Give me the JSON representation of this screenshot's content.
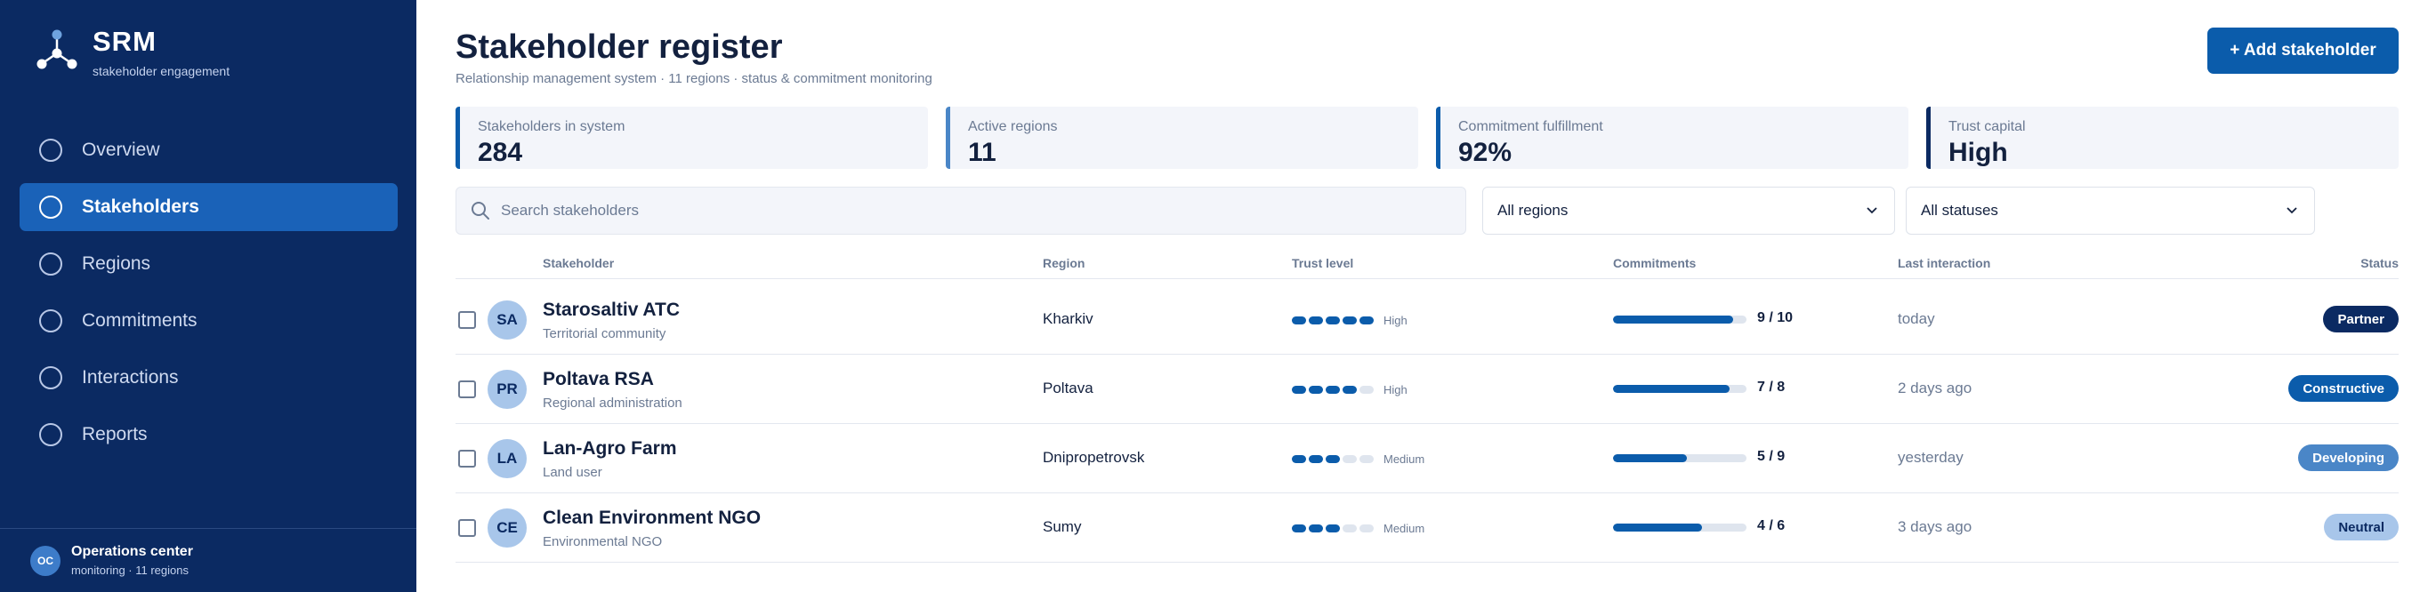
{
  "brand": {
    "name": "SRM",
    "subtitle": "stakeholder engagement"
  },
  "sidebar": {
    "items": [
      {
        "label": "Overview",
        "active": false
      },
      {
        "label": "Stakeholders",
        "active": true
      },
      {
        "label": "Regions",
        "active": false
      },
      {
        "label": "Commitments",
        "active": false
      },
      {
        "label": "Interactions",
        "active": false
      },
      {
        "label": "Reports",
        "active": false
      }
    ],
    "footer": {
      "initials": "OC",
      "title": "Operations center",
      "subtitle": "monitoring · 11 regions"
    }
  },
  "header": {
    "title": "Stakeholder register",
    "subtitle": "Relationship management system · 11 regions · status & commitment monitoring",
    "add_button": "+ Add stakeholder"
  },
  "stats": [
    {
      "label": "Stakeholders in system",
      "value": "284",
      "accent": "#0b5cab"
    },
    {
      "label": "Active regions",
      "value": "11",
      "accent": "#4a86c7"
    },
    {
      "label": "Commitment fulfillment",
      "value": "92%",
      "accent": "#0b5cab"
    },
    {
      "label": "Trust capital",
      "value": "High",
      "accent": "#0b2a62"
    }
  ],
  "filters": {
    "search_placeholder": "Search stakeholders",
    "region": "All regions",
    "status": "All statuses"
  },
  "table": {
    "headers": {
      "stakeholder": "Stakeholder",
      "region": "Region",
      "trust": "Trust level",
      "commitments": "Commitments",
      "last": "Last interaction",
      "status": "Status"
    },
    "rows": [
      {
        "initials": "SA",
        "name": "Starosaltiv ATC",
        "type": "Territorial community",
        "region": "Kharkiv",
        "trust_level": 5,
        "trust_label": "High",
        "commit_done": 9,
        "commit_total": 10,
        "commitments": "9 / 10",
        "last": "today",
        "status": "Partner",
        "status_bg": "#0b2a62",
        "status_fg": "#ffffff"
      },
      {
        "initials": "PR",
        "name": "Poltava RSA",
        "type": "Regional administration",
        "region": "Poltava",
        "trust_level": 4,
        "trust_label": "High",
        "commit_done": 7,
        "commit_total": 8,
        "commitments": "7 / 8",
        "last": "2 days ago",
        "status": "Constructive",
        "status_bg": "#0b5cab",
        "status_fg": "#ffffff"
      },
      {
        "initials": "LA",
        "name": "Lan-Agro Farm",
        "type": "Land user",
        "region": "Dnipropetrovsk",
        "trust_level": 3,
        "trust_label": "Medium",
        "commit_done": 5,
        "commit_total": 9,
        "commitments": "5 / 9",
        "last": "yesterday",
        "status": "Developing",
        "status_bg": "#4a86c7",
        "status_fg": "#ffffff"
      },
      {
        "initials": "CE",
        "name": "Clean Environment NGO",
        "type": "Environmental NGO",
        "region": "Sumy",
        "trust_level": 3,
        "trust_label": "Medium",
        "commit_done": 4,
        "commit_total": 6,
        "commitments": "4 / 6",
        "last": "3 days ago",
        "status": "Neutral",
        "status_bg": "#a8c6ea",
        "status_fg": "#0b2a62"
      }
    ]
  }
}
